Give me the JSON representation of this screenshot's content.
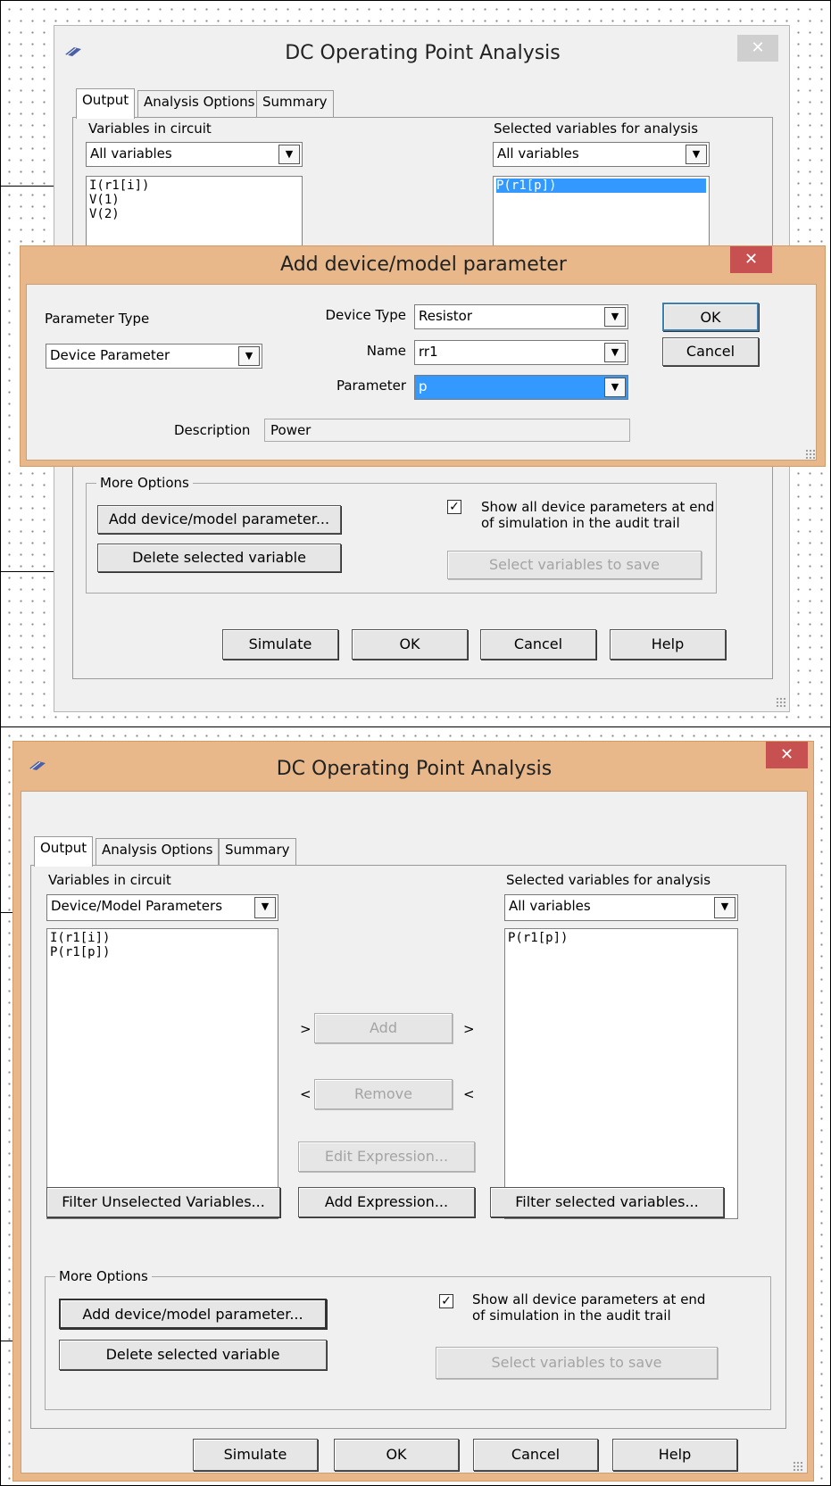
{
  "top": {
    "dialog": {
      "title": "DC Operating Point Analysis",
      "close_glyph": "✕",
      "tabs": [
        "Output",
        "Analysis Options",
        "Summary"
      ],
      "vars_label": "Variables in circuit",
      "vars_filter": "All variables",
      "vars_list": [
        "I(r1[i])",
        "V(1)",
        "V(2)"
      ],
      "selected_label": "Selected variables for analysis",
      "selected_filter": "All variables",
      "selected_list": [
        "P(r1[p])"
      ],
      "more_options": "More Options",
      "add_param_btn": "Add device/model parameter...",
      "delete_btn": "Delete selected variable",
      "show_all_text_1": "Show all device parameters at end",
      "show_all_text_2": "of simulation in the audit trail",
      "select_save_btn": "Select variables to save",
      "simulate_btn": "Simulate",
      "ok_btn": "OK",
      "cancel_btn": "Cancel",
      "help_btn": "Help"
    },
    "popup": {
      "title": "Add device/model parameter",
      "close_glyph": "✕",
      "param_type_label": "Parameter Type",
      "param_type_value": "Device Parameter",
      "device_type_label": "Device Type",
      "device_type_value": "Resistor",
      "name_label": "Name",
      "name_value": "rr1",
      "parameter_label": "Parameter",
      "parameter_value": "p",
      "description_label": "Description",
      "description_value": "Power",
      "ok_btn": "OK",
      "cancel_btn": "Cancel"
    }
  },
  "bottom": {
    "dialog": {
      "title": "DC Operating Point Analysis",
      "close_glyph": "✕",
      "tabs": [
        "Output",
        "Analysis Options",
        "Summary"
      ],
      "vars_label": "Variables in circuit",
      "vars_filter": "Device/Model Parameters",
      "vars_list": [
        "I(r1[i])",
        "P(r1[p])"
      ],
      "selected_label": "Selected variables for analysis",
      "selected_filter": "All variables",
      "selected_list": [
        "P(r1[p])"
      ],
      "add_btn": "Add",
      "remove_btn": "Remove",
      "gt": ">",
      "lt": "<",
      "edit_expr_btn": "Edit Expression...",
      "add_expr_btn": "Add Expression...",
      "filter_unsel_btn": "Filter Unselected Variables...",
      "filter_sel_btn": "Filter selected variables...",
      "more_options": "More Options",
      "add_param_btn": "Add device/model parameter...",
      "delete_btn": "Delete selected variable",
      "show_all_text_1": "Show all device parameters at end",
      "show_all_text_2": "of simulation in the audit trail",
      "select_save_btn": "Select variables to save",
      "simulate_btn": "Simulate",
      "ok_btn": "OK",
      "cancel_btn": "Cancel",
      "help_btn": "Help"
    }
  },
  "icons": {
    "app": "multisim-logo-icon",
    "dropdown": "chevron-down-icon",
    "check": "checkmark-icon",
    "resize": "resize-grip-icon"
  },
  "colors": {
    "selection": "#3399ff",
    "title_orange": "#e8b88a",
    "close_red": "#c75050"
  }
}
